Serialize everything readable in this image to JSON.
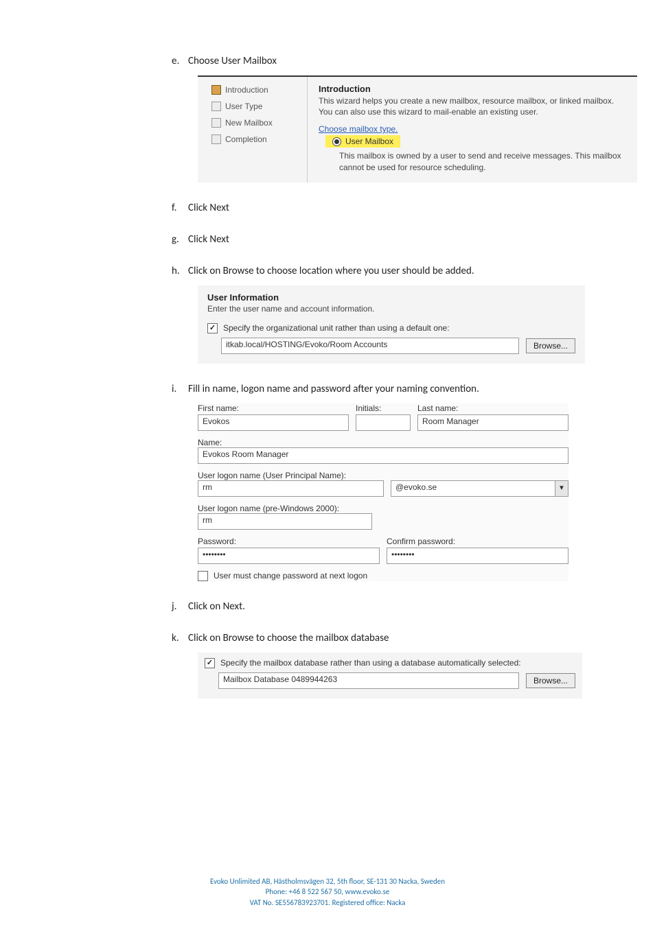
{
  "steps": {
    "e": {
      "marker": "e.",
      "text": "Choose User Mailbox"
    },
    "f": {
      "marker": "f.",
      "text": "Click Next"
    },
    "g": {
      "marker": "g.",
      "text": "Click Next"
    },
    "h": {
      "marker": "h.",
      "text": "Click on Browse to choose location where you user should be added."
    },
    "i": {
      "marker": "i.",
      "text": "Fill in name, logon name and password after your naming convention."
    },
    "j": {
      "marker": "j.",
      "text": "Click on Next."
    },
    "k": {
      "marker": "k.",
      "text": "Click on Browse to choose the mailbox database"
    }
  },
  "fig1": {
    "nav": {
      "introduction": "Introduction",
      "user_type": "User Type",
      "new_mailbox": "New Mailbox",
      "completion": "Completion"
    },
    "header": "Introduction",
    "desc": "This wizard helps you create a new mailbox, resource mailbox, or linked mailbox. You can also use this wizard to mail-enable an existing user.",
    "choose_label": "Choose mailbox type.",
    "radio_label": "User Mailbox",
    "radio_desc": "This mailbox is owned by a user to send and receive messages. This mailbox cannot be used for resource scheduling."
  },
  "fig2": {
    "header": "User Information",
    "sub": "Enter the user name and account information.",
    "checkbox_label": "Specify the organizational unit rather than using a default one:",
    "path_value": "itkab.local/HOSTING/Evoko/Room Accounts",
    "browse": "Browse..."
  },
  "fig3": {
    "labels": {
      "first_name": "First name:",
      "initials": "Initials:",
      "last_name": "Last name:",
      "name": "Name:",
      "upn": "User logon name (User Principal Name):",
      "pre2000": "User logon name (pre-Windows 2000):",
      "password": "Password:",
      "confirm": "Confirm password:",
      "must_change": "User must change password at next logon"
    },
    "values": {
      "first_name": "Evokos",
      "initials": "",
      "last_name": "Room Manager",
      "name": "Evokos Room Manager",
      "upn_user": "rm",
      "upn_domain": "@evoko.se",
      "pre2000": "rm",
      "password": "••••••••",
      "confirm": "••••••••"
    }
  },
  "fig4": {
    "checkbox_label": "Specify the mailbox database rather than using a database automatically selected:",
    "db_value": "Mailbox Database 0489944263",
    "browse": "Browse..."
  },
  "footer": {
    "line1_pre": "Evoko Unlimited AB,  Hästholmsvägen 32, 5th floor, SE-131 30 Nacka, Sweden",
    "line2_pre": "Phone: +46 8 522 567 50,  ",
    "line2_link": "www.evoko.se",
    "line3": "VAT No. SE556783923701. Registered office: Nacka"
  }
}
